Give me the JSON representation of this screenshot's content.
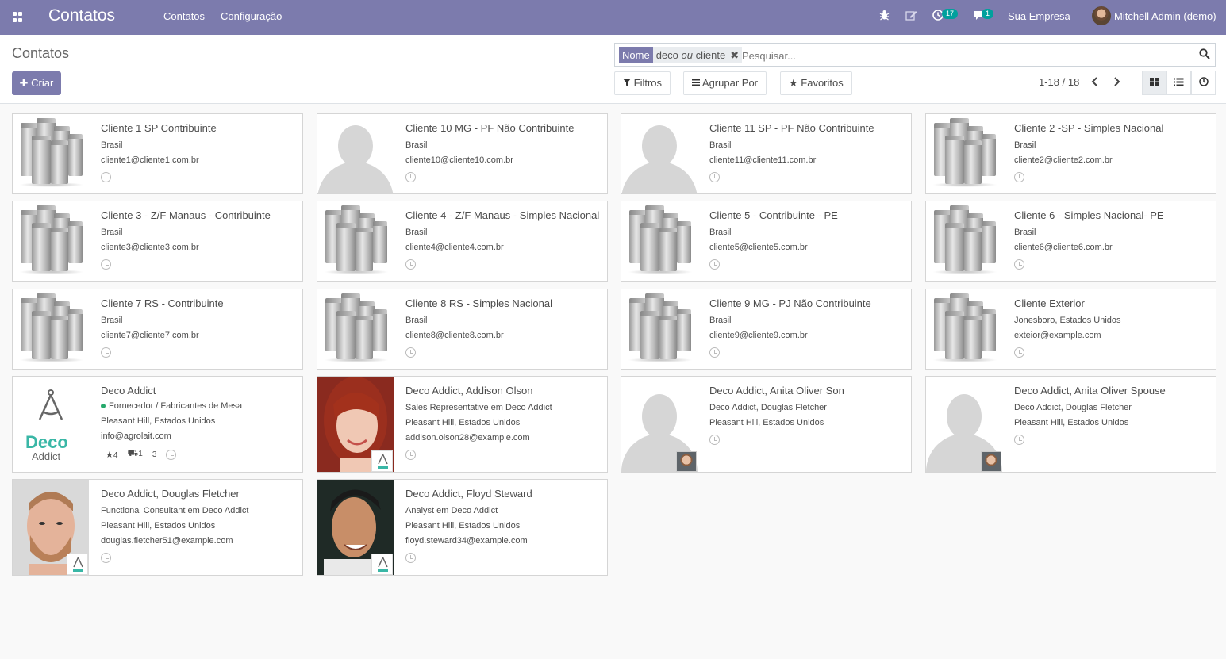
{
  "navbar": {
    "brand": "Contatos",
    "menu": [
      "Contatos",
      "Configuração"
    ],
    "activity_count": "17",
    "message_count": "1",
    "company": "Sua Empresa",
    "user": "Mitchell Admin (demo)",
    "accent_color": "#7c7bad"
  },
  "control": {
    "breadcrumb": "Contatos",
    "create_label": "Criar",
    "facet_label": "Nome",
    "facet_value_a": "deco",
    "facet_value_or": "ou",
    "facet_value_b": "cliente",
    "search_placeholder": "Pesquisar...",
    "filters_label": "Filtros",
    "group_label": "Agrupar Por",
    "favorites_label": "Favoritos",
    "pager": "1-18 / 18"
  },
  "cards": [
    {
      "name": "Cliente 1 SP Contribuinte",
      "line1": "Brasil",
      "line2": "cliente1@cliente1.com.br",
      "image": "building"
    },
    {
      "name": "Cliente 10 MG - PF Não Contribuinte",
      "line1": "Brasil",
      "line2": "cliente10@cliente10.com.br",
      "image": "person"
    },
    {
      "name": "Cliente 11 SP - PF Não Contribuinte",
      "line1": "Brasil",
      "line2": "cliente11@cliente11.com.br",
      "image": "person"
    },
    {
      "name": "Cliente 2 -SP - Simples Nacional",
      "line1": "Brasil",
      "line2": "cliente2@cliente2.com.br",
      "image": "building"
    },
    {
      "name": "Cliente 3 - Z/F Manaus - Contribuinte",
      "line1": "Brasil",
      "line2": "cliente3@cliente3.com.br",
      "image": "building"
    },
    {
      "name": "Cliente 4 - Z/F Manaus - Simples Nacional",
      "line1": "Brasil",
      "line2": "cliente4@cliente4.com.br",
      "image": "building"
    },
    {
      "name": "Cliente 5 - Contribuinte - PE",
      "line1": "Brasil",
      "line2": "cliente5@cliente5.com.br",
      "image": "building"
    },
    {
      "name": "Cliente 6 - Simples Nacional- PE",
      "line1": "Brasil",
      "line2": "cliente6@cliente6.com.br",
      "image": "building"
    },
    {
      "name": "Cliente 7 RS - Contribuinte",
      "line1": "Brasil",
      "line2": "cliente7@cliente7.com.br",
      "image": "building"
    },
    {
      "name": "Cliente 8 RS - Simples Nacional",
      "line1": "Brasil",
      "line2": "cliente8@cliente8.com.br",
      "image": "building"
    },
    {
      "name": "Cliente 9 MG - PJ Não Contribuinte",
      "line1": "Brasil",
      "line2": "cliente9@cliente9.com.br",
      "image": "building"
    },
    {
      "name": "Cliente Exterior",
      "line1": "Jonesboro, Estados Unidos",
      "line2": "exteior@example.com",
      "image": "building"
    },
    {
      "name": "Deco Addict",
      "tag": "Fornecedor / Fabricantes de Mesa",
      "line1": "Pleasant Hill, Estados Unidos",
      "line2": "info@agrolait.com",
      "image": "deco-logo",
      "stat_star": "4",
      "stat_truck": "1",
      "stat_count": "3",
      "logo_word1": "Deco",
      "logo_word2": "Addict"
    },
    {
      "name": "Deco Addict, Addison Olson",
      "line1": "Sales Representative em Deco Addict",
      "line2": "Pleasant Hill, Estados Unidos",
      "line3": "addison.olson28@example.com",
      "image": "photo-woman"
    },
    {
      "name": "Deco Addict, Anita Oliver Son",
      "line1": "Deco Addict, Douglas Fletcher",
      "line2": "Pleasant Hill, Estados Unidos",
      "image": "person-with-face"
    },
    {
      "name": "Deco Addict, Anita Oliver Spouse",
      "line1": "Deco Addict, Douglas Fletcher",
      "line2": "Pleasant Hill, Estados Unidos",
      "image": "person-with-face"
    },
    {
      "name": "Deco Addict, Douglas Fletcher",
      "line1": "Functional Consultant em Deco Addict",
      "line2": "Pleasant Hill, Estados Unidos",
      "line3": "douglas.fletcher51@example.com",
      "image": "photo-man1"
    },
    {
      "name": "Deco Addict, Floyd Steward",
      "line1": "Analyst em Deco Addict",
      "line2": "Pleasant Hill, Estados Unidos",
      "line3": "floyd.steward34@example.com",
      "image": "photo-man2"
    }
  ],
  "colors": {
    "tag_green": "#26a96c",
    "logo_teal": "#3ab7a6",
    "logo_gray": "#666666"
  }
}
